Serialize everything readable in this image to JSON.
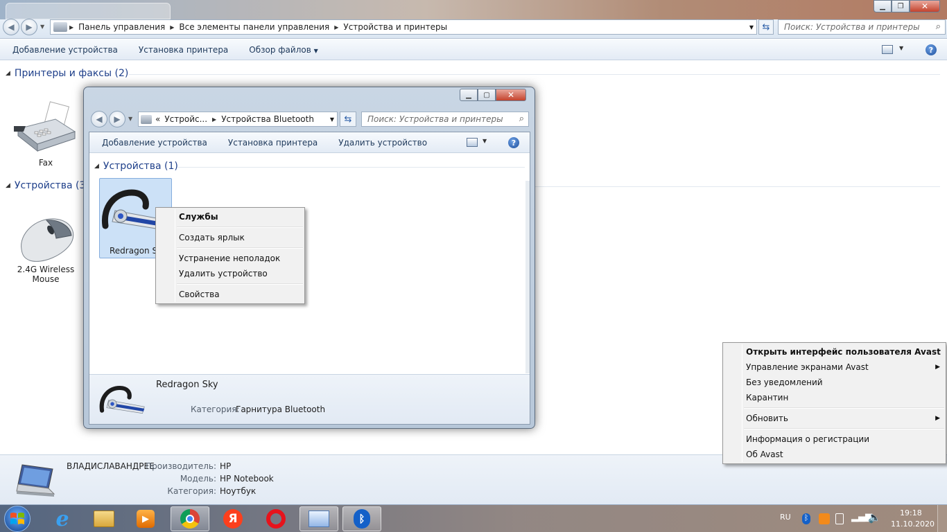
{
  "explorer": {
    "address": [
      "Панель управления",
      "Все элементы панели управления",
      "Устройства и принтеры"
    ],
    "search_placeholder": "Поиск: Устройства и принтеры",
    "commands": [
      "Добавление устройства",
      "Установка принтера",
      "Обзор файлов"
    ],
    "groups": {
      "printers": "Принтеры и факсы (2)",
      "devices": "Устройства (3)"
    },
    "devices": {
      "fax": "Fax",
      "mouse_line1": "2.4G Wireless",
      "mouse_line2": "Mouse"
    },
    "details": {
      "name": "ВЛАДИСЛАВАНДРЕЕ",
      "manufacturer_label": "Производитель:",
      "manufacturer": "HP",
      "model_label": "Модель:",
      "model": "HP Notebook",
      "category_label": "Категория:",
      "category": "Ноутбук"
    }
  },
  "bluetooth_window": {
    "address": [
      "Устройс...",
      "Устройства Bluetooth"
    ],
    "address_prefix": "«",
    "search_placeholder": "Поиск: Устройства и принтеры",
    "commands": [
      "Добавление устройства",
      "Установка принтера",
      "Удалить устройство"
    ],
    "group": "Устройства (1)",
    "device_label": "Redragon Sky",
    "details": {
      "name": "Redragon Sky",
      "category_label": "Категория:",
      "category": "Гарнитура Bluetooth"
    }
  },
  "device_context_menu": {
    "items": [
      "Службы",
      "Создать ярлык",
      "Устранение неполадок",
      "Удалить устройство",
      "Свойства"
    ]
  },
  "avast_menu": {
    "items": [
      "Открыть интерфейс пользователя Avast",
      "Управление экранами Avast",
      "Без уведомлений",
      "Карантин",
      "Обновить",
      "Информация о регистрации",
      "Об Avast"
    ]
  },
  "taskbar": {
    "language": "RU",
    "time": "19:18",
    "date": "11.10.2020"
  },
  "icons": [
    "back-icon",
    "forward-icon",
    "refresh-icon",
    "search-icon",
    "help-icon",
    "fax-icon",
    "mouse-icon",
    "headset-icon",
    "laptop-icon",
    "start-orb",
    "ie-icon",
    "explorer-icon",
    "media-player-icon",
    "chrome-icon",
    "yandex-icon",
    "opera-icon",
    "control-panel-icon",
    "bluetooth-icon",
    "avast-icon",
    "volume-icon",
    "signal-icon"
  ],
  "colors": {
    "group_heading": "#1e3f8a",
    "command_text": "#1e395b",
    "close_button": "#c4422c",
    "selection": "#cce1f7"
  }
}
